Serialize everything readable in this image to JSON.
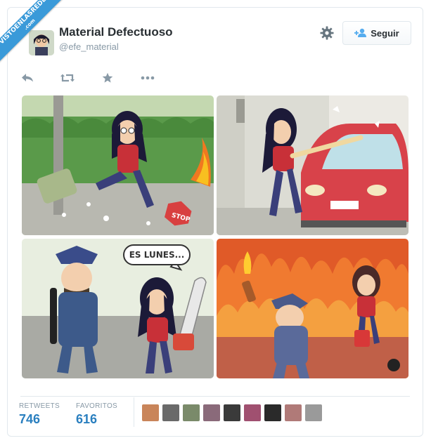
{
  "watermark": {
    "line1": "VISTOENLASREDES",
    "line2": ".com"
  },
  "author": {
    "name": "Material Defectuoso",
    "handle": "@efe_material",
    "avatar_icon": "avatar-illustration"
  },
  "header": {
    "follow_label": "Seguir",
    "gear_icon": "gear-icon",
    "follow_icon": "add-user-icon"
  },
  "actions": [
    {
      "icon": "reply-icon"
    },
    {
      "icon": "retweet-icon"
    },
    {
      "icon": "favorite-star-icon"
    },
    {
      "icon": "more-icon"
    }
  ],
  "media": {
    "panels": [
      {
        "name": "panel-kick-mailbox"
      },
      {
        "name": "panel-smash-car"
      },
      {
        "name": "panel-police-chainsaw",
        "speech": "ES LUNES..."
      },
      {
        "name": "panel-fire-molotov"
      }
    ]
  },
  "stats": {
    "retweets_label": "RETWEETS",
    "retweets_value": "746",
    "favorites_label": "FAVORITOS",
    "favorites_value": "616"
  },
  "favoriters_count_shown": 9,
  "colors": {
    "accent": "#2a7fbf",
    "ribbon": "#3a9ad9",
    "muted": "#8899a6",
    "border": "#e1e8ed"
  }
}
